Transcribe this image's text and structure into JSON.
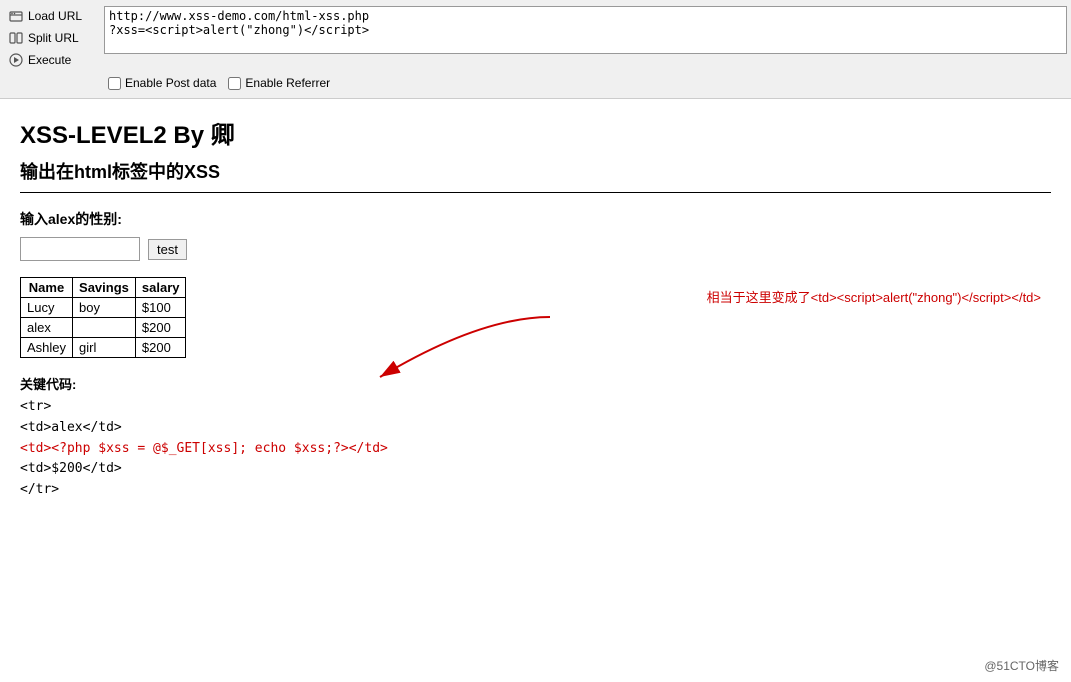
{
  "toolbar": {
    "load_url_label": "Load URL",
    "split_url_label": "Split URL",
    "execute_label": "Execute",
    "url_value": "http://www.xss-demo.com/html-xss.php\n?xss=<script>alert(\"zhong\")</script>",
    "enable_post_label": "Enable Post data",
    "enable_referrer_label": "Enable Referrer"
  },
  "page": {
    "title": "XSS-LEVEL2 By 卿",
    "subtitle": "输出在html标签中的XSS",
    "input_label": "输入alex的性别:",
    "input_placeholder": "",
    "test_button": "test"
  },
  "table": {
    "headers": [
      "Name",
      "Savings",
      "salary"
    ],
    "rows": [
      [
        "Lucy",
        "boy",
        "$100"
      ],
      [
        "alex",
        "",
        "$200"
      ],
      [
        "Ashley",
        "girl",
        "$200"
      ]
    ]
  },
  "code_section": {
    "label": "关键代码:",
    "lines": [
      "<tr>",
      "    <td>alex</td>",
      "    <td><?php $xss = @$_GET[xss]; echo $xss;?></td>",
      "    <td>$200</td>",
      "</tr>"
    ]
  },
  "annotation": {
    "text": "相当于这里变成了<td><script>alert(\"zhong\")</script></td>"
  },
  "footer": {
    "text": "@51CTO博客"
  }
}
